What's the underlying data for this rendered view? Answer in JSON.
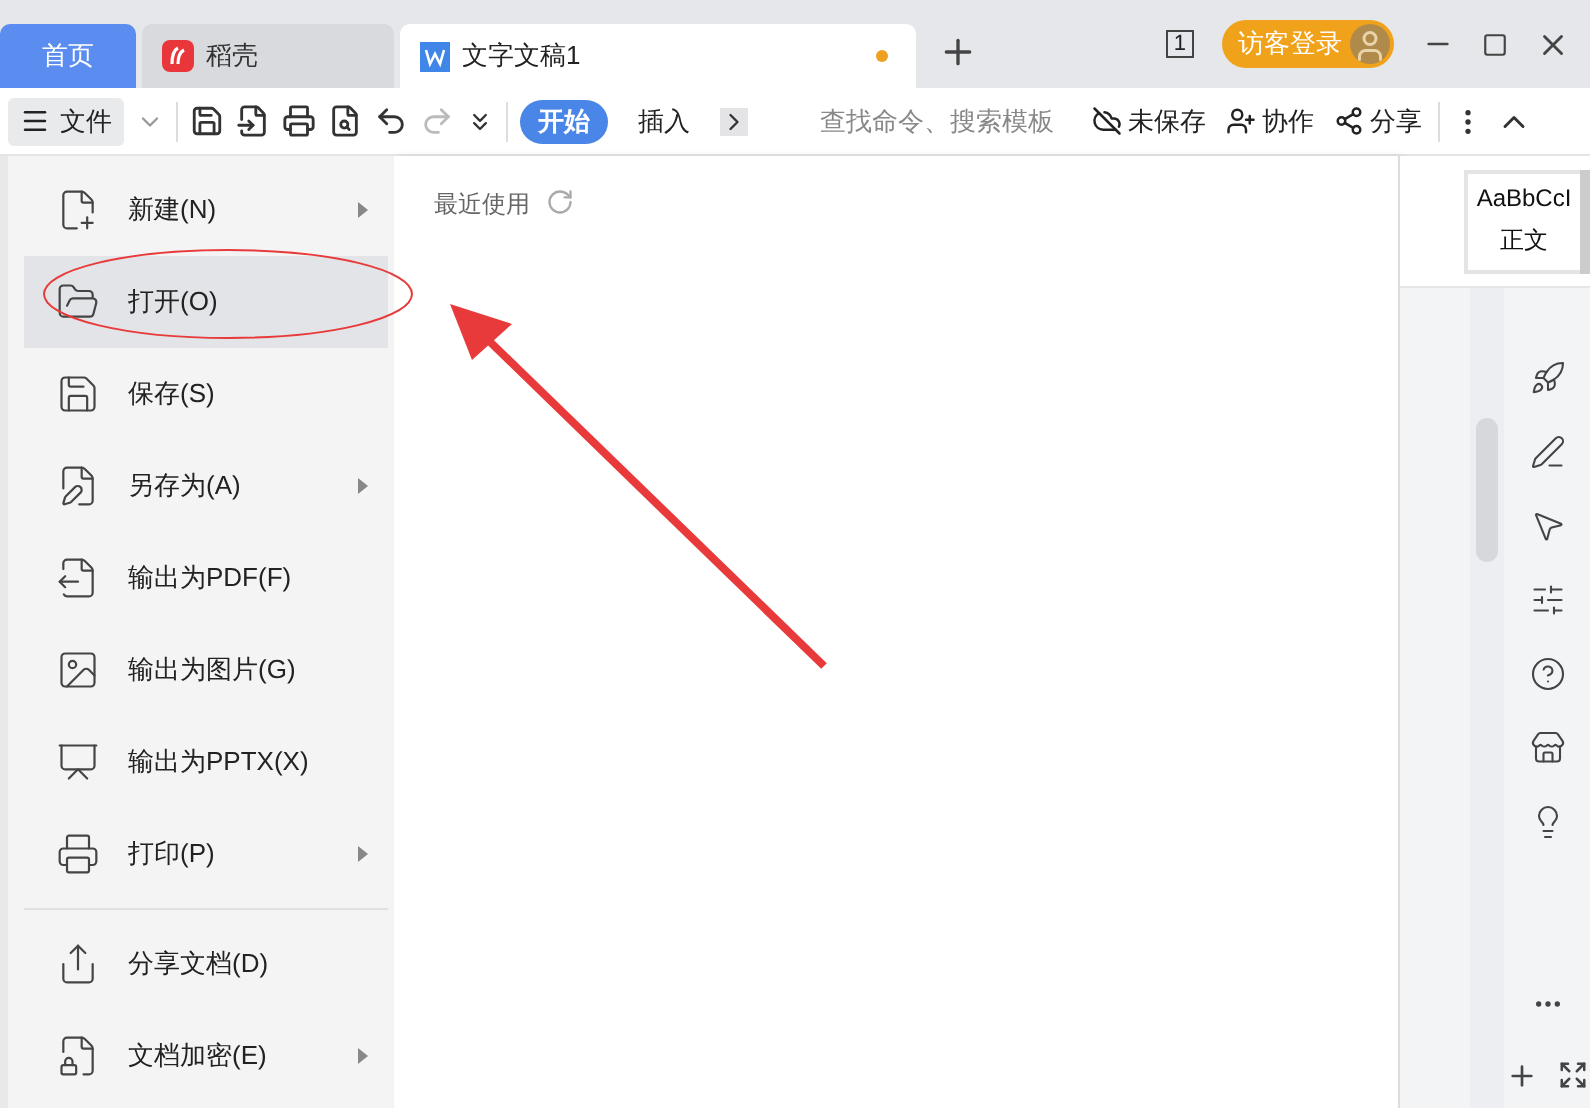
{
  "tabs": [
    {
      "kind": "home",
      "label": "首页",
      "selected": false
    },
    {
      "kind": "app",
      "label": "稻壳",
      "selected": false
    },
    {
      "kind": "doc",
      "label": "文字文稿1",
      "selected": true,
      "unsaved": true
    }
  ],
  "account": {
    "window_count": "1",
    "login": "访客登录"
  },
  "toolbar": {
    "file_label": "文件",
    "ribbon_tabs": [
      {
        "label": "开始",
        "selected": true
      },
      {
        "label": "插入",
        "selected": false
      }
    ],
    "search_placeholder": "查找命令、搜索模板",
    "actions": [
      "未保存",
      "协作",
      "分享"
    ],
    "redo_disabled": true
  },
  "file_menu": [
    {
      "label": "新建(N)",
      "submenu": true,
      "selected": false,
      "divider_before": false
    },
    {
      "label": "打开(O)",
      "submenu": false,
      "selected": true,
      "divider_before": false
    },
    {
      "label": "保存(S)",
      "submenu": false,
      "selected": false,
      "divider_before": false
    },
    {
      "label": "另存为(A)",
      "submenu": true,
      "selected": false,
      "divider_before": false
    },
    {
      "label": "输出为PDF(F)",
      "submenu": false,
      "selected": false,
      "divider_before": false
    },
    {
      "label": "输出为图片(G)",
      "submenu": false,
      "selected": false,
      "divider_before": false
    },
    {
      "label": "输出为PPTX(X)",
      "submenu": false,
      "selected": false,
      "divider_before": false
    },
    {
      "label": "打印(P)",
      "submenu": true,
      "selected": false,
      "divider_before": false
    },
    {
      "label": "分享文档(D)",
      "submenu": false,
      "selected": false,
      "divider_before": true
    },
    {
      "label": "文档加密(E)",
      "submenu": true,
      "selected": false,
      "divider_before": false
    }
  ],
  "recent": {
    "title": "最近使用"
  },
  "style_gallery": {
    "sample": "AaBbCcI",
    "name": "正文"
  }
}
